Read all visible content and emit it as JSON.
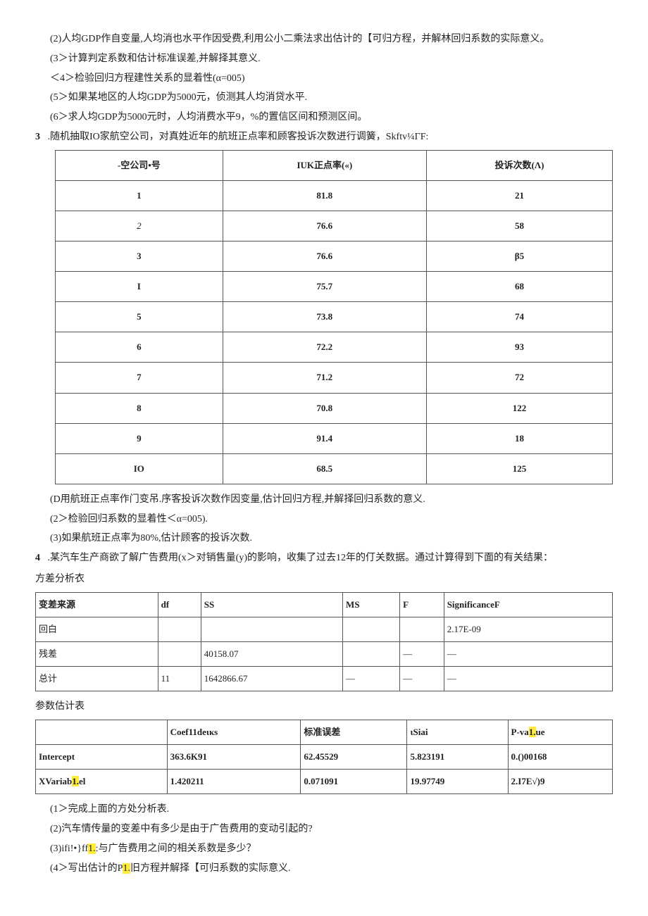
{
  "q2_2": "(2)人均GDP作自变量,人均消也水平作因受费,利用公小二乘法求出估计的【可归方程，并解林回归系数的实际意义。",
  "q2_3": "(3＞计算判定系数和估计标准误差,并解择其意义.",
  "q2_4": "＜4＞检验回归方程建性关系的显着性(α=005)",
  "q2_5": "(5＞如果某地区的人均GDP为5000元，侦测其人均消贷水平.",
  "q2_6": "(6＞求人均GDP为5000元时，人均消费水平9，%的置信区间和预测区间。",
  "q3_prefix": "3",
  "q3_stem": ".随机抽取IO家航空公司，对真姓近年的航班正点率和顾客投诉次数进行调簧，Skftv¼ΓF:",
  "t1": {
    "h1": "-空公司•号",
    "h2": "IUK正点率(«)",
    "h3": "投诉次数(Λ)",
    "rows": [
      {
        "c1": "1",
        "c2": "81.8",
        "c3": "21"
      },
      {
        "c1": "2",
        "c2": "76.6",
        "c3": "58"
      },
      {
        "c1": "3",
        "c2": "76.6",
        "c3": "β5"
      },
      {
        "c1": "I",
        "c2": "75.7",
        "c3": "68"
      },
      {
        "c1": "5",
        "c2": "73.8",
        "c3": "74"
      },
      {
        "c1": "6",
        "c2": "72.2",
        "c3": "93"
      },
      {
        "c1": "7",
        "c2": "71.2",
        "c3": "72"
      },
      {
        "c1": "8",
        "c2": "70.8",
        "c3": "122"
      },
      {
        "c1": "9",
        "c2": "91.4",
        "c3": "18"
      },
      {
        "c1": "IO",
        "c2": "68.5",
        "c3": "125"
      }
    ]
  },
  "q3_1": "(D用航班正点率作门变吊.序客投诉次数作因变量,估计回归方程,并解择回归系数的意义.",
  "q3_2": "(2＞检验回归系数的显着性＜α=005).",
  "q3_3": "(3)如果航班正点率为80%,估计顾客的投诉次数.",
  "q4_prefix": "4",
  "q4_stem": ".某汽车生产商欲了解广告费用(x＞对销售量(y)的影响，收集了过去12年的仃关数据。通过计算得到下面的有关结果：",
  "anova_label": "方差分析衣",
  "t2": {
    "h1": "变差来源",
    "h2": "df",
    "h3": "SS",
    "h4": "MS",
    "h5": "F",
    "h6": "SignificanceF",
    "rows": [
      {
        "c1": "回白",
        "c2": "",
        "c3": "",
        "c4": "",
        "c5": "",
        "c6": "2.17E-09"
      },
      {
        "c1": "残差",
        "c2": "",
        "c3": "40158.07",
        "c4": "",
        "c5": "—",
        "c6": "—"
      },
      {
        "c1": "总计",
        "c2": "11",
        "c3": "1642866.67",
        "c4": "—",
        "c5": "—",
        "c6": "—"
      }
    ]
  },
  "param_label": "参数估计表",
  "t3": {
    "h1": "",
    "h2": "Coef11deικs",
    "h3": "标准误差",
    "h4": "ιSiai",
    "h5_a": "P-va",
    "h5_b": "1.",
    "h5_c": "ue",
    "rows": [
      {
        "c1": "Intercept",
        "c2": "363.6K91",
        "c3": "62.45529",
        "c4": "5.823191",
        "c5": "0.()00168"
      },
      {
        "c1_a": "XVariab",
        "c1_b": "1.",
        "c1_c": "el",
        "c2": "1.420211",
        "c3": "0.071091",
        "c4": "19.97749",
        "c5": "2.I7E√)9"
      }
    ]
  },
  "q4_1": "(1＞完成上面的方处分析表.",
  "q4_2": "(2)汽车情传量的变差中有多少是由于广告费用的变动引起的?",
  "q4_3_a": "(3)ifi!•}ff",
  "q4_3_b": "1.",
  "q4_3_c": ":与广告费用之间的相关系数是多少？",
  "q4_4_a": "(4＞写出估计的P",
  "q4_4_b": "1.",
  "q4_4_c": "旧方程并解择【可归系数的实际意义."
}
